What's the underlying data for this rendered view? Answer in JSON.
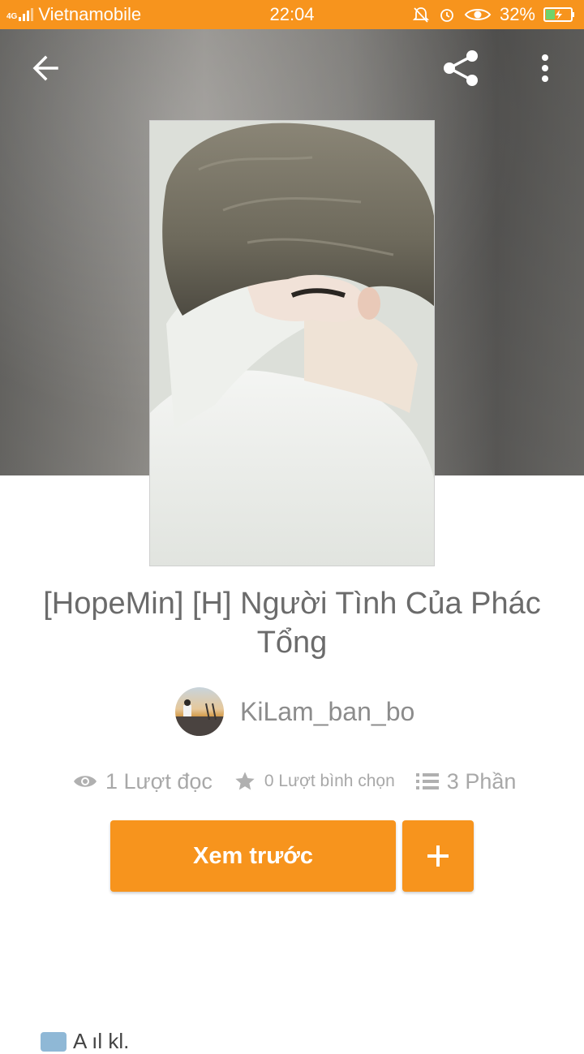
{
  "status_bar": {
    "network": "4G",
    "carrier": "Vietnamobile",
    "time": "22:04",
    "battery": "32%",
    "icons": [
      "mute-bell-icon",
      "alarm-icon",
      "eye-icon",
      "battery-charging-icon"
    ]
  },
  "toolbar": {
    "icons": [
      "back-arrow-icon",
      "share-icon",
      "more-vert-icon"
    ]
  },
  "story": {
    "title": "[HopeMin] [H] Người Tình Của Phác Tổng",
    "author": "KiLam_ban_bo",
    "reads": "1 Lượt đọc",
    "votes": "0 Lượt bình chọn",
    "parts": "3 Phần"
  },
  "actions": {
    "preview_label": "Xem trước",
    "add_icon": "plus-icon"
  },
  "bottom": {
    "partial_text": "A ıl   kl."
  },
  "colors": {
    "accent": "#f7941d",
    "text_gray": "#6b6b6b",
    "stat_gray": "#a8a8a8"
  }
}
